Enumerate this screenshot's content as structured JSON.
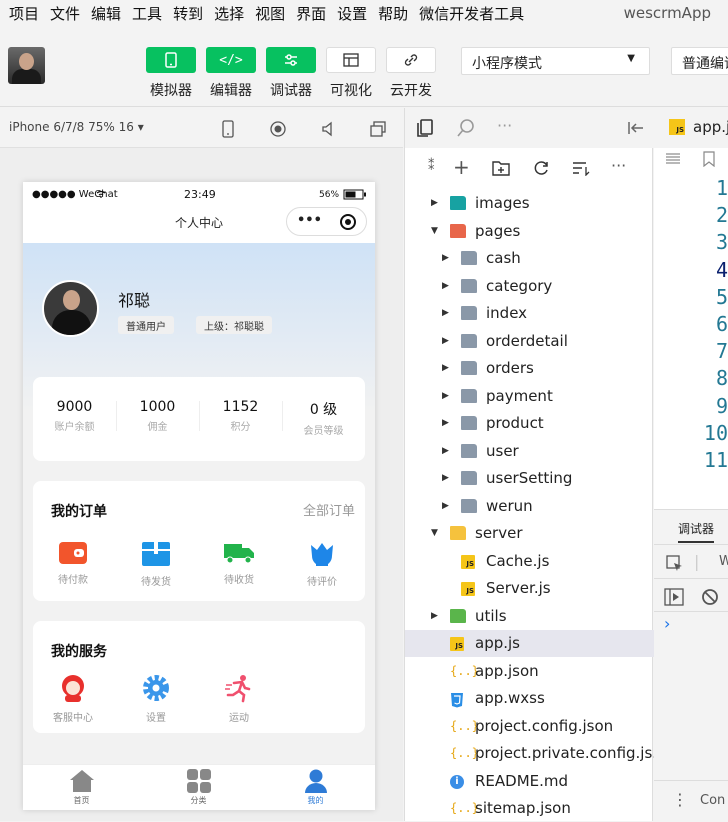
{
  "menu": {
    "items": [
      "项目",
      "文件",
      "编辑",
      "工具",
      "转到",
      "选择",
      "视图",
      "界面",
      "设置",
      "帮助",
      "微信开发者工具"
    ],
    "app_name": "wescrmApp"
  },
  "toolbar": {
    "simulator": "模拟器",
    "editor": "编辑器",
    "debugger": "调试器",
    "visual": "可视化",
    "cloud": "云开发",
    "mode": "小程序模式",
    "compile": "普通编译"
  },
  "simbar": {
    "device": "iPhone 6/7/8 75% 16 ▾"
  },
  "phone": {
    "status_left": "●●●●● WeChat",
    "time": "23:49",
    "battery": "56%",
    "nav_title": "个人中心",
    "user": {
      "name": "祁聪",
      "role": "普通用户",
      "superior": "上级：祁聪聪"
    },
    "stats": [
      {
        "value": "9000",
        "label": "账户余额"
      },
      {
        "value": "1000",
        "label": "佣金"
      },
      {
        "value": "1152",
        "label": "积分"
      },
      {
        "value": "0 级",
        "label": "会员等级"
      }
    ],
    "orders": {
      "title": "我的订单",
      "all": "全部订单",
      "items": [
        "待付款",
        "待发货",
        "待收货",
        "待评价"
      ]
    },
    "services": {
      "title": "我的服务",
      "items": [
        "客服中心",
        "设置",
        "运动"
      ]
    },
    "tabs": [
      "首页",
      "分类",
      "我的"
    ],
    "colors": {
      "tab_active": "#2e7bd6",
      "tab_inactive": "#888888",
      "pay": "#f2552c",
      "ship": "#1e95e6",
      "receive": "#22b34b",
      "review": "#1e86e8",
      "service": "#e8302c",
      "settings": "#3a96ea",
      "sport": "#f0506e"
    }
  },
  "explorer": {
    "rows": [
      {
        "name": "images",
        "type": "folder-img",
        "level": 1,
        "arrow": "▶"
      },
      {
        "name": "pages",
        "type": "folder-pages",
        "level": 1,
        "arrow": "▼"
      },
      {
        "name": "cash",
        "type": "folder",
        "level": 2,
        "arrow": "▶"
      },
      {
        "name": "category",
        "type": "folder",
        "level": 2,
        "arrow": "▶"
      },
      {
        "name": "index",
        "type": "folder",
        "level": 2,
        "arrow": "▶"
      },
      {
        "name": "orderdetail",
        "type": "folder",
        "level": 2,
        "arrow": "▶"
      },
      {
        "name": "orders",
        "type": "folder",
        "level": 2,
        "arrow": "▶"
      },
      {
        "name": "payment",
        "type": "folder",
        "level": 2,
        "arrow": "▶"
      },
      {
        "name": "product",
        "type": "folder",
        "level": 2,
        "arrow": "▶"
      },
      {
        "name": "user",
        "type": "folder",
        "level": 2,
        "arrow": "▶"
      },
      {
        "name": "userSetting",
        "type": "folder",
        "level": 2,
        "arrow": "▶"
      },
      {
        "name": "werun",
        "type": "folder",
        "level": 2,
        "arrow": "▶"
      },
      {
        "name": "server",
        "type": "folder-server",
        "level": 1,
        "arrow": "▼"
      },
      {
        "name": "Cache.js",
        "type": "js",
        "level": 2,
        "arrow": ""
      },
      {
        "name": "Server.js",
        "type": "js",
        "level": 2,
        "arrow": ""
      },
      {
        "name": "utils",
        "type": "folder-utils",
        "level": 1,
        "arrow": "▶"
      },
      {
        "name": "app.js",
        "type": "js",
        "level": 1,
        "arrow": "",
        "selected": true
      },
      {
        "name": "app.json",
        "type": "json",
        "level": 1,
        "arrow": ""
      },
      {
        "name": "app.wxss",
        "type": "wxss",
        "level": 1,
        "arrow": ""
      },
      {
        "name": "project.config.json",
        "type": "json",
        "level": 1,
        "arrow": ""
      },
      {
        "name": "project.private.config.js...",
        "type": "json",
        "level": 1,
        "arrow": ""
      },
      {
        "name": "README.md",
        "type": "info",
        "level": 1,
        "arrow": ""
      },
      {
        "name": "sitemap.json",
        "type": "json",
        "level": 1,
        "arrow": ""
      }
    ]
  },
  "editor": {
    "tab": "app.js",
    "line_numbers": [
      "1",
      "2",
      "3",
      "4",
      "5",
      "6",
      "7",
      "8",
      "9",
      "10",
      "11"
    ],
    "debug_tab": "调试器",
    "console_prompt": "›",
    "console_label": "Con",
    "context_filter": "W"
  }
}
